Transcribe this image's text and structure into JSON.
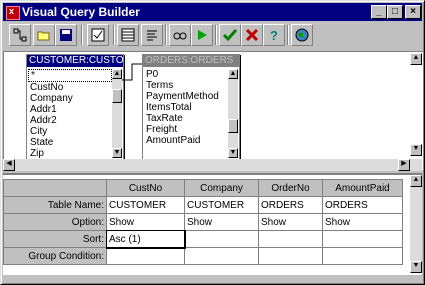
{
  "window": {
    "title": "Visual Query Builder",
    "icon_letter": "x",
    "controls": [
      "_",
      "□",
      "×"
    ]
  },
  "toolbar": {
    "icons": [
      "join-icon",
      "open-folder-icon",
      "save-icon",
      "checklist-icon",
      "grid-view-icon",
      "sql-icon",
      "glasses-icon",
      "run-icon",
      "accept-icon",
      "cancel-icon",
      "help-icon",
      "globe-icon"
    ]
  },
  "tables": [
    {
      "header": "CUSTOMER:CUSTOM",
      "fields": [
        "*",
        "CustNo",
        "Company",
        "Addr1",
        "Addr2",
        "City",
        "State",
        "Zip"
      ]
    },
    {
      "header": "ORDERS:ORDERS",
      "fields": [
        "P0",
        "Terms",
        "PaymentMethod",
        "ItemsTotal",
        "TaxRate",
        "Freight",
        "AmountPaid"
      ]
    }
  ],
  "grid": {
    "columns": [
      "CustNo",
      "Company",
      "OrderNo",
      "AmountPaid"
    ],
    "rows": [
      {
        "label": "Table Name:",
        "cells": [
          "CUSTOMER",
          "CUSTOMER",
          "ORDERS",
          "ORDERS"
        ]
      },
      {
        "label": "Option:",
        "cells": [
          "Show",
          "Show",
          "Show",
          "Show"
        ]
      },
      {
        "label": "Sort:",
        "cells": [
          "Asc (1)",
          "",
          "",
          ""
        ]
      },
      {
        "label": "Group Condition:",
        "cells": [
          "",
          "",
          "",
          ""
        ]
      }
    ]
  }
}
